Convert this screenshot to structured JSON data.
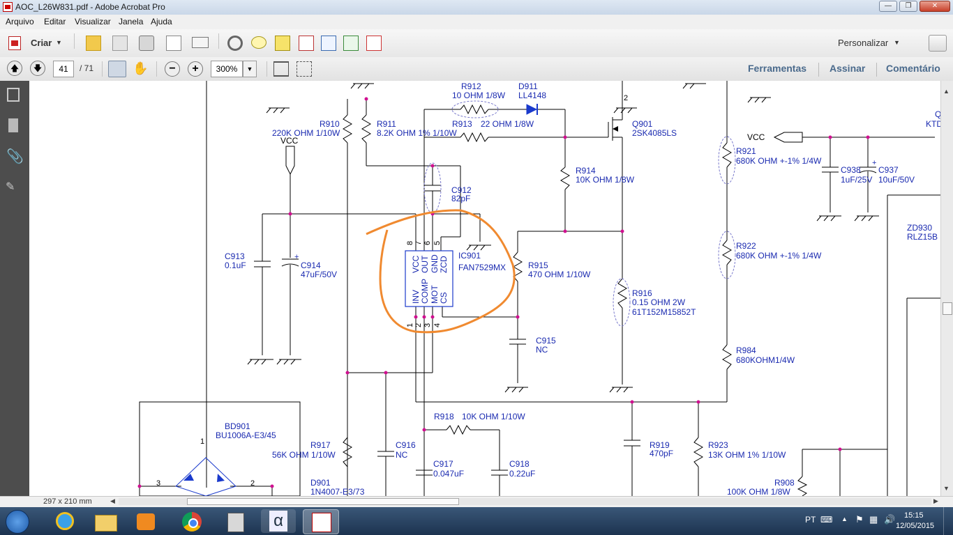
{
  "window": {
    "title": "AOC_L26W831.pdf - Adobe Acrobat Pro"
  },
  "menu": [
    "Arquivo",
    "Editar",
    "Visualizar",
    "Janela",
    "Ajuda"
  ],
  "toolbar": {
    "create_label": "Criar",
    "customize_label": "Personalizar",
    "tool_icons": [
      "open-icon",
      "save-icon",
      "print-icon",
      "edit-icon",
      "email-icon",
      "settings-icon",
      "comment-icon",
      "stamp-icon",
      "redact-icon",
      "search-doc-icon",
      "export-icon",
      "form-icon"
    ]
  },
  "nav": {
    "page_current": "41",
    "page_total": "/ 71",
    "zoom": "300%",
    "links": [
      "Ferramentas",
      "Assinar",
      "Comentário"
    ]
  },
  "status": {
    "page_size": "297 x 210 mm"
  },
  "taskbar": {
    "language": "PT",
    "time": "15:15",
    "date": "12/05/2015",
    "apps": [
      "internet-explorer-icon",
      "file-explorer-icon",
      "media-player-icon",
      "chrome-icon",
      "calculator-icon",
      "alpha-app-icon",
      "acrobat-icon"
    ]
  },
  "schematic": {
    "labels": {
      "r912": "R912",
      "r912v": "10 OHM 1/8W",
      "d911": "D911",
      "d911v": "LL4148",
      "r913": "R913",
      "r913v": "22 OHM 1/8W",
      "q901": "Q901",
      "q901v": "2SK4085LS",
      "r910": "R910",
      "r910v": "220K OHM 1/10W",
      "r911": "R911",
      "r911v": "8.2K OHM 1% 1/10W",
      "vcc_left": "VCC",
      "c912": "C912",
      "c912v": "82pF",
      "r914": "R914",
      "r914v": "10K OHM 1/8W",
      "c913": "C913",
      "c913v": "0.1uF",
      "c914": "C914",
      "c914v": "47uF/50V",
      "ic901": "IC901",
      "ic901v": "FAN7529MX",
      "pin_vcc": "VCC",
      "pin_out": "OUT",
      "pin_gnd": "GND",
      "pin_zcd": "ZCD",
      "pin_inv": "INV",
      "pin_comp": "COMP",
      "pin_mot": "MOT",
      "pin_cs": "CS",
      "pin8": "8",
      "pin7": "7",
      "pin6": "6",
      "pin5": "5",
      "pin1": "1",
      "pin2": "2",
      "pin3": "3",
      "pin4": "4",
      "r915": "R915",
      "r915v": "470 OHM 1/10W",
      "r916": "R916",
      "r916v": "0.15 OHM 2W",
      "r916p": "61T152M15852T",
      "c915": "C915",
      "c915v": "NC",
      "vcc_right": "VCC",
      "r921": "R921",
      "r921v": "680K OHM +-1% 1/4W",
      "c938": "C938",
      "c938v": "1uF/25V",
      "c937": "C937",
      "c937v": "10uF/50V",
      "r922": "R922",
      "r922v": "680K OHM +-1% 1/4W",
      "zd930": "ZD930",
      "zd930v": "RLZ15B",
      "r984": "R984",
      "r984v": "680KOHM1/4W",
      "bd901": "BD901",
      "bd901v": "BU1006A-E3/45",
      "bd_pin1": "1",
      "bd_pin2": "2",
      "bd_pin3": "3",
      "r917": "R917",
      "r917v": "56K OHM 1/10W",
      "c916": "C916",
      "c916v": "NC",
      "r918": "R918",
      "r918v": "10K OHM 1/10W",
      "c917": "C917",
      "c917v": "0.047uF",
      "c918": "C918",
      "c918v": "0.22uF",
      "r919": "R919",
      "r919v": "470pF",
      "r923": "R923",
      "r923v": "13K OHM 1% 1/10W",
      "r908": "R908",
      "r908v": "100K OHM 1/8W",
      "d901": "D901",
      "d901v": "1N4007-E3/73",
      "q_edge": "Q",
      "ktd_edge": "KTD",
      "q2pin": "2",
      "plus1": "+",
      "plus2": "+"
    }
  }
}
